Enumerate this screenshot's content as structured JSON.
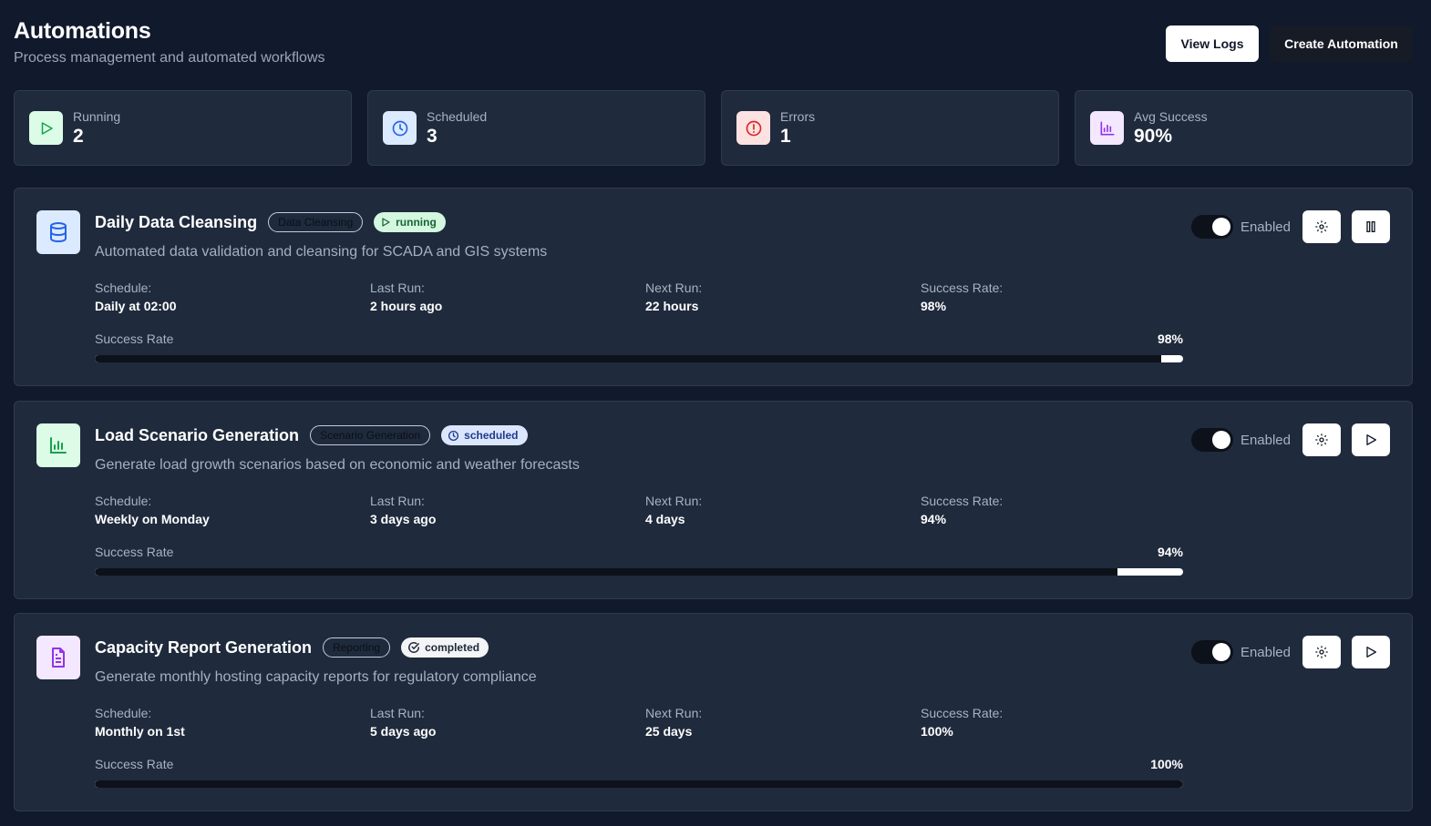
{
  "header": {
    "title": "Automations",
    "subtitle": "Process management and automated workflows",
    "view_logs_label": "View Logs",
    "create_label": "Create Automation"
  },
  "stats": [
    {
      "label": "Running",
      "value": "2",
      "icon": "play-icon",
      "bg": "#dcfce7",
      "color": "#16a34a"
    },
    {
      "label": "Scheduled",
      "value": "3",
      "icon": "clock-icon",
      "bg": "#dbeafe",
      "color": "#2563eb"
    },
    {
      "label": "Errors",
      "value": "1",
      "icon": "alert-circle-icon",
      "bg": "#fee2e2",
      "color": "#dc2626"
    },
    {
      "label": "Avg Success",
      "value": "90%",
      "icon": "bar-chart-icon",
      "bg": "#f3e8ff",
      "color": "#9333ea"
    }
  ],
  "labels": {
    "schedule": "Schedule:",
    "last_run": "Last Run:",
    "next_run": "Next Run:",
    "success_rate": "Success Rate:",
    "progress": "Success Rate",
    "enabled": "Enabled"
  },
  "automations": [
    {
      "title": "Daily Data Cleansing",
      "category": "Data Cleansing",
      "status": "running",
      "description": "Automated data validation and cleansing for SCADA and GIS systems",
      "schedule": "Daily at 02:00",
      "last_run": "2 hours ago",
      "next_run": "22 hours",
      "success_rate": "98%",
      "success_fraction": 0.98,
      "icon": "database-icon",
      "icon_bg": "#dbeafe",
      "icon_color": "#2563eb",
      "action": "pause-icon"
    },
    {
      "title": "Load Scenario Generation",
      "category": "Scenario Generation",
      "status": "scheduled",
      "description": "Generate load growth scenarios based on economic and weather forecasts",
      "schedule": "Weekly on Monday",
      "last_run": "3 days ago",
      "next_run": "4 days",
      "success_rate": "94%",
      "success_fraction": 0.94,
      "icon": "bar-chart-icon",
      "icon_bg": "#dcfce7",
      "icon_color": "#16a34a",
      "action": "play-icon"
    },
    {
      "title": "Capacity Report Generation",
      "category": "Reporting",
      "status": "completed",
      "description": "Generate monthly hosting capacity reports for regulatory compliance",
      "schedule": "Monthly on 1st",
      "last_run": "5 days ago",
      "next_run": "25 days",
      "success_rate": "100%",
      "success_fraction": 1.0,
      "icon": "file-text-icon",
      "icon_bg": "#f3e8ff",
      "icon_color": "#9333ea",
      "action": "play-icon"
    }
  ]
}
